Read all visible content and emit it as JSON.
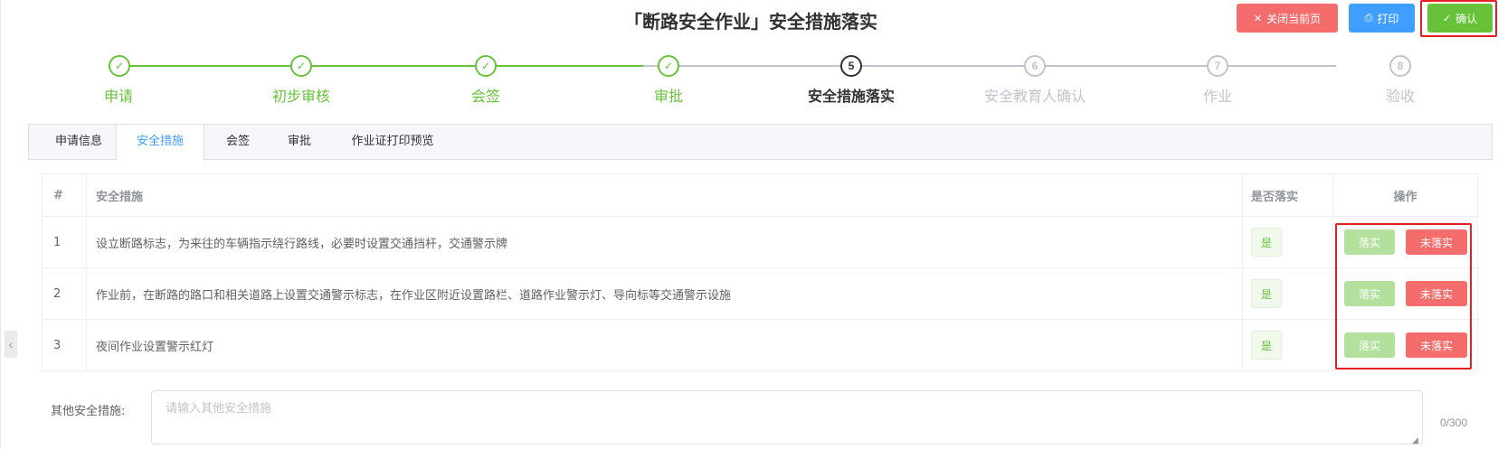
{
  "page": {
    "title": "「断路安全作业」安全措施落实"
  },
  "toolbar": {
    "close_label": "关闭当前页",
    "print_label": "打印",
    "confirm_label": "确认"
  },
  "steps": [
    {
      "index": "1",
      "label": "申请",
      "status": "done"
    },
    {
      "index": "2",
      "label": "初步审核",
      "status": "done"
    },
    {
      "index": "3",
      "label": "会签",
      "status": "done"
    },
    {
      "index": "4",
      "label": "审批",
      "status": "done"
    },
    {
      "index": "5",
      "label": "安全措施落实",
      "status": "active"
    },
    {
      "index": "6",
      "label": "安全教育人确认",
      "status": "pending"
    },
    {
      "index": "7",
      "label": "作业",
      "status": "pending"
    },
    {
      "index": "8",
      "label": "验收",
      "status": "pending"
    }
  ],
  "tabs": [
    {
      "label": "申请信息"
    },
    {
      "label": "安全措施",
      "active": true
    },
    {
      "label": "会签"
    },
    {
      "label": "审批"
    },
    {
      "label": "作业证打印预览"
    }
  ],
  "table": {
    "headers": [
      "#",
      "安全措施",
      "是否落实",
      "操作"
    ],
    "rows": [
      {
        "index": "1",
        "measure": "设立断路标志，为来往的车辆指示绕行路线，必要时设置交通挡杆，交通警示牌",
        "implemented": "是",
        "ok_label": "落实",
        "no_label": "未落实"
      },
      {
        "index": "2",
        "measure": "作业前，在断路的路口和相关道路上设置交通警示标志，在作业区附近设置路栏、道路作业警示灯、导向标等交通警示设施",
        "implemented": "是",
        "ok_label": "落实",
        "no_label": "未落实"
      },
      {
        "index": "3",
        "measure": "夜间作业设置警示红灯",
        "implemented": "是",
        "ok_label": "落实",
        "no_label": "未落实"
      }
    ]
  },
  "other_measures": {
    "label": "其他安全措施:",
    "placeholder": "请输入其他安全措施",
    "value": "",
    "counter": "0/300"
  },
  "colors": {
    "success": "#67c23a",
    "danger": "#f56c6c",
    "primary": "#409eff",
    "highlight_border": "#e81c25"
  },
  "icons": {
    "close": "close-icon",
    "print": "printer-icon",
    "confirm": "check-icon",
    "step_done": "check-icon",
    "collapse": "chevron-left-icon"
  }
}
